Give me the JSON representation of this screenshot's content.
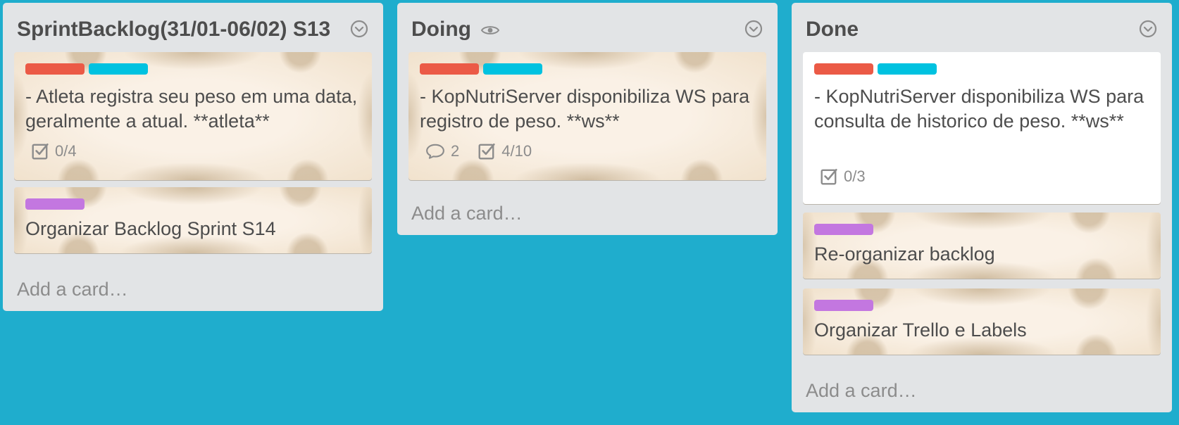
{
  "colors": {
    "board_background": "#1fadcd",
    "list_background": "#e2e4e6",
    "label_red": "#eb5a46",
    "label_blue": "#00c2e0",
    "label_purple": "#c377e0"
  },
  "lists": [
    {
      "title": "SprintBacklog(31/01-06/02) S13",
      "menu_icon": "chevron-circle-down-icon",
      "add_card": "Add a card…",
      "cards": [
        {
          "labels": [
            "red",
            "blue"
          ],
          "title": "- Atleta registra seu peso em uma data, geralmente a atual. **atleta**",
          "checklist": "0/4"
        },
        {
          "labels": [
            "purple"
          ],
          "title": "Organizar Backlog Sprint S14"
        }
      ]
    },
    {
      "title": "Doing",
      "watch_icon": "eye-icon",
      "menu_icon": "chevron-circle-down-icon",
      "add_card": "Add a card…",
      "cards": [
        {
          "labels": [
            "red",
            "blue"
          ],
          "title": "- KopNutriServer disponibiliza WS para registro de peso. **ws**",
          "comments": "2",
          "checklist": "4/10"
        }
      ]
    },
    {
      "title": "Done",
      "menu_icon": "chevron-circle-down-icon",
      "add_card": "Add a card…",
      "cards": [
        {
          "labels": [
            "red",
            "blue"
          ],
          "title": "- KopNutriServer disponibiliza WS para consulta de historico de peso. **ws**",
          "checklist": "0/3"
        },
        {
          "labels": [
            "purple"
          ],
          "title": "Re-organizar backlog"
        },
        {
          "labels": [
            "purple"
          ],
          "title": "Organizar Trello e Labels"
        }
      ]
    }
  ]
}
